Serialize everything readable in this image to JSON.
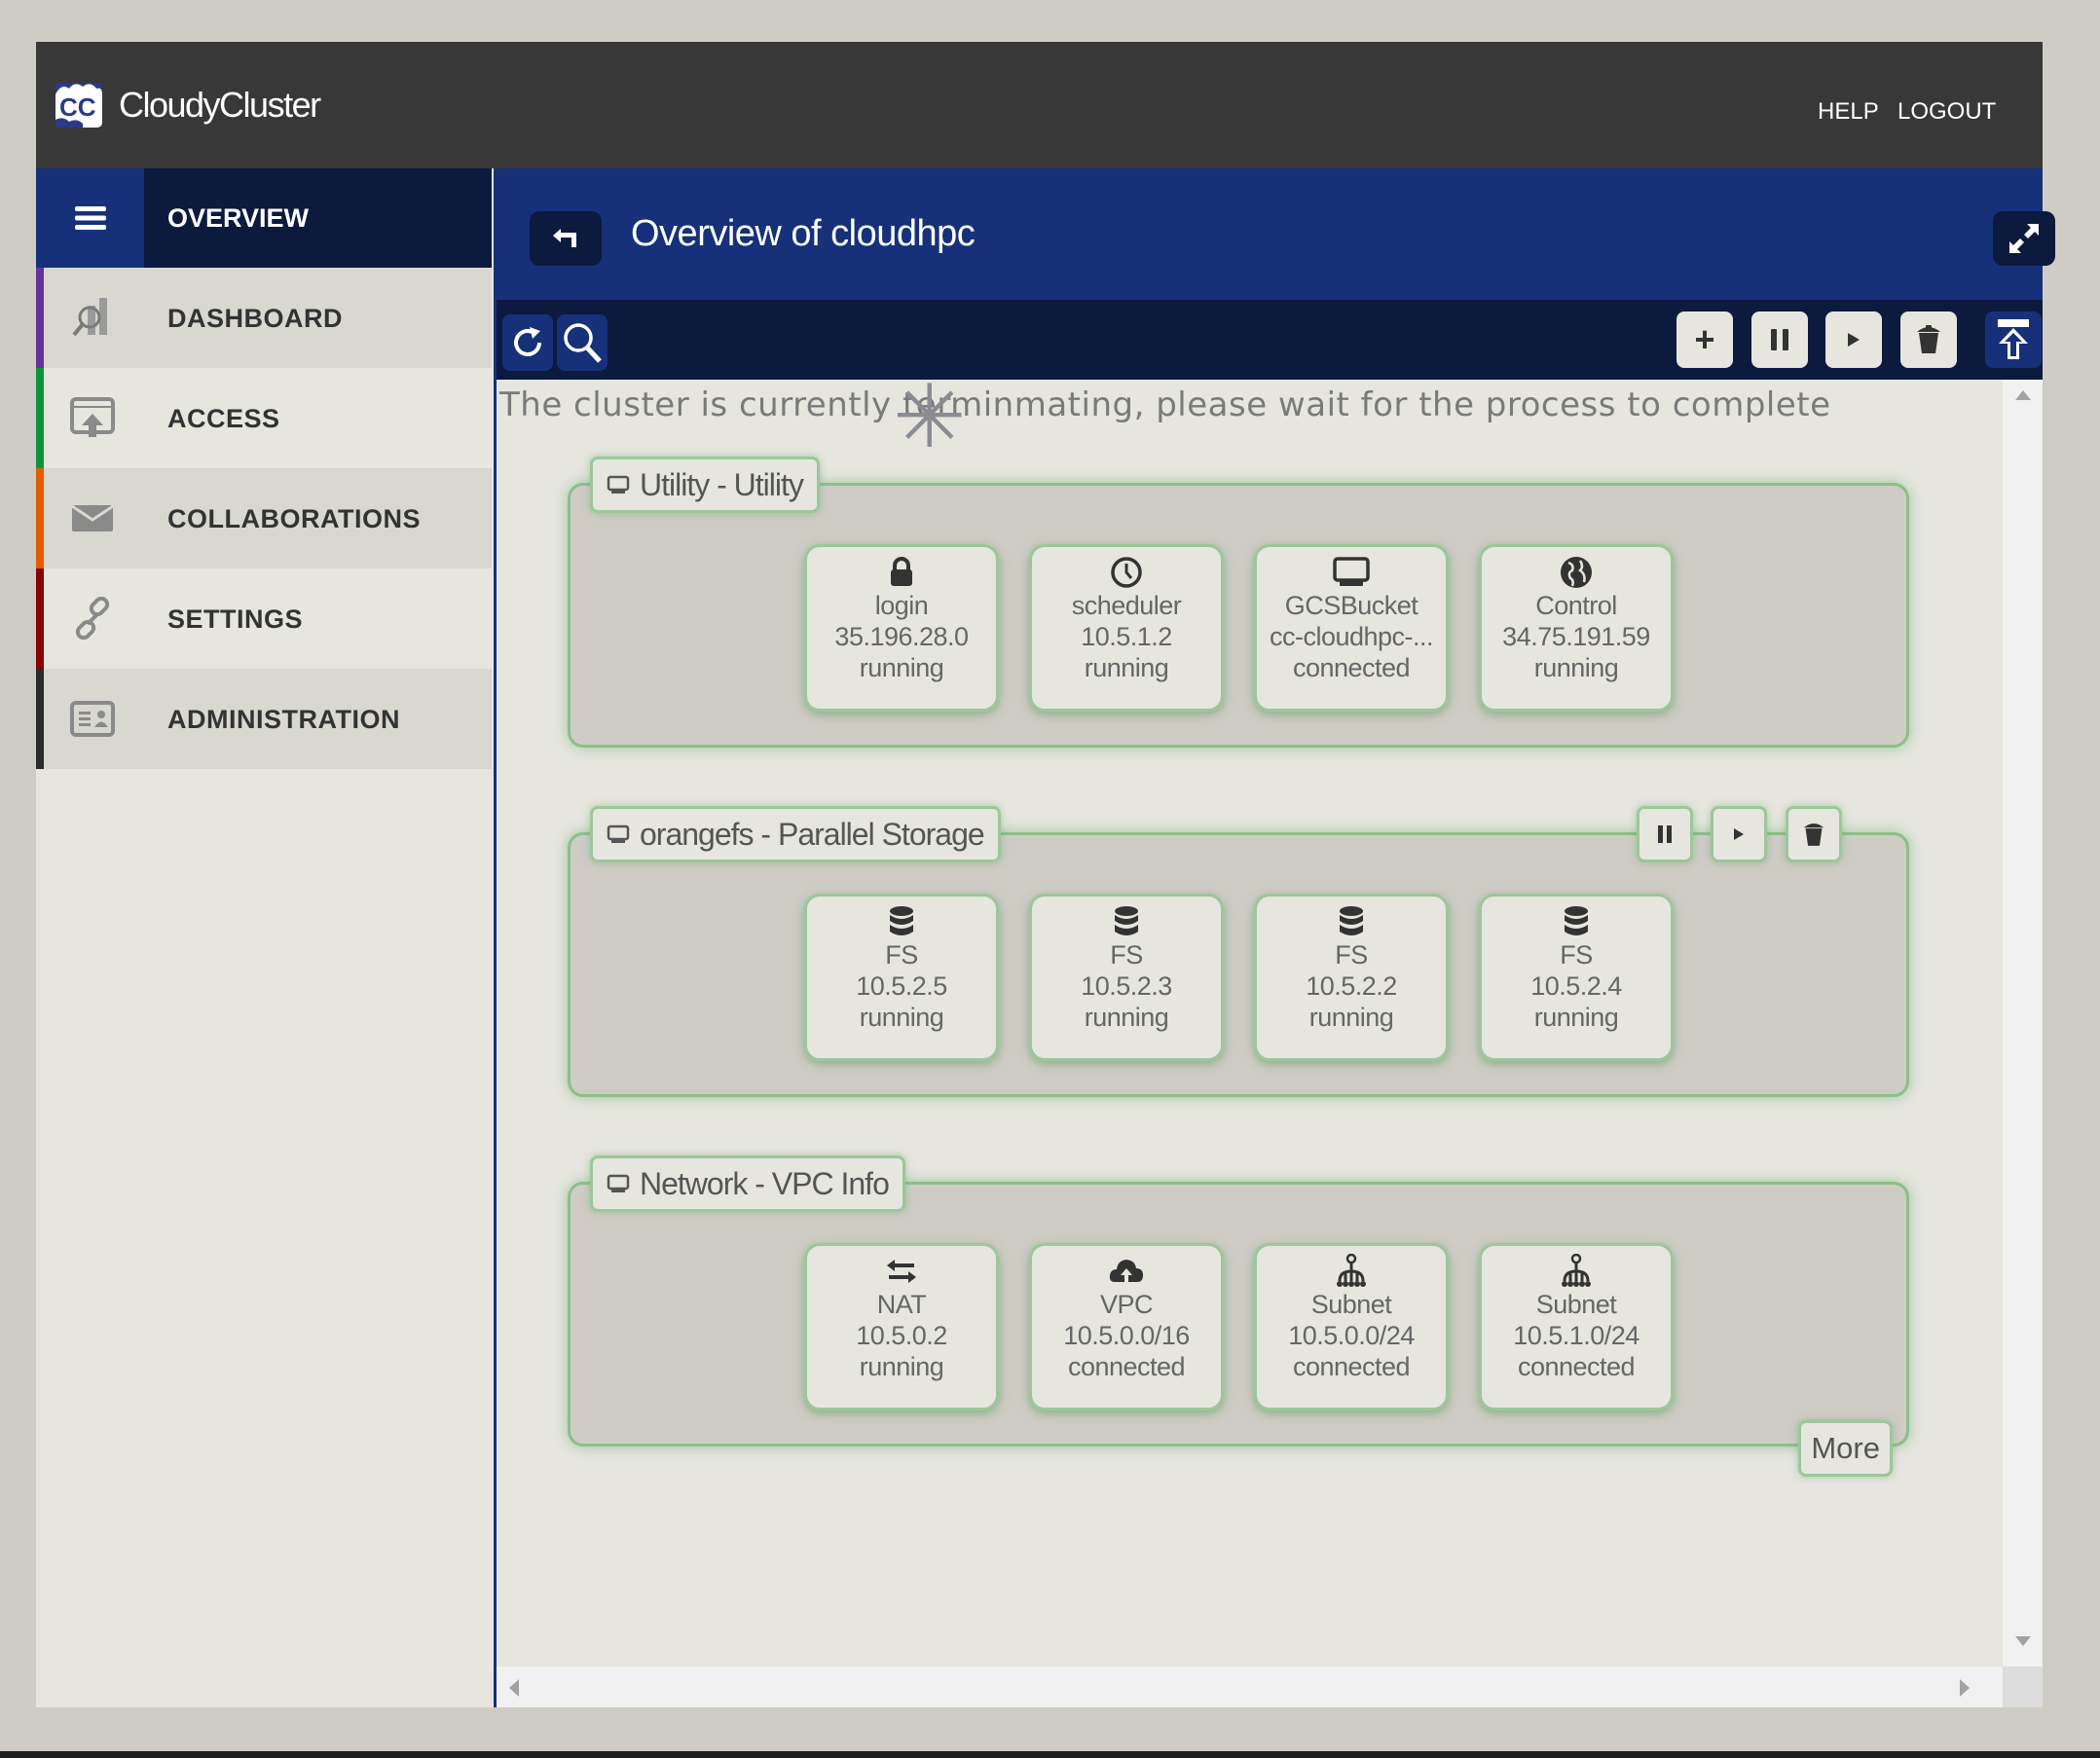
{
  "header": {
    "brand": "CloudyCluster",
    "help": "HELP",
    "logout": "LOGOUT"
  },
  "sidebar": {
    "overview_label": "OVERVIEW",
    "items": [
      {
        "label": "DASHBOARD",
        "icon": "dashboard-icon",
        "color": "#663399"
      },
      {
        "label": "ACCESS",
        "icon": "access-icon",
        "color": "#0a9637"
      },
      {
        "label": "COLLABORATIONS",
        "icon": "envelope-icon",
        "color": "#e35d00"
      },
      {
        "label": "SETTINGS",
        "icon": "link-icon",
        "color": "#8b0000"
      },
      {
        "label": "ADMINISTRATION",
        "icon": "id-card-icon",
        "color": "#2b2b2b"
      }
    ]
  },
  "main": {
    "title": "Overview of cloudhpc",
    "notice": "The cluster is currently terminmating, please wait for the process to complete",
    "toolbar": {
      "add": "+",
      "pause": "pause",
      "play": "play",
      "delete": "delete",
      "upload": "upload"
    },
    "groups": [
      {
        "title": "Utility - Utility",
        "has_actions": false,
        "nodes": [
          {
            "icon": "lock-icon",
            "name": "login",
            "address": "35.196.28.0",
            "status": "running"
          },
          {
            "icon": "clock-icon",
            "name": "scheduler",
            "address": "10.5.1.2",
            "status": "running"
          },
          {
            "icon": "monitor-icon",
            "name": "GCSBucket",
            "address": "cc-cloudhpc-...",
            "status": "connected"
          },
          {
            "icon": "globe-icon",
            "name": "Control",
            "address": "34.75.191.59",
            "status": "running"
          }
        ]
      },
      {
        "title": "orangefs - Parallel Storage",
        "has_actions": true,
        "nodes": [
          {
            "icon": "database-icon",
            "name": "FS",
            "address": "10.5.2.5",
            "status": "running"
          },
          {
            "icon": "database-icon",
            "name": "FS",
            "address": "10.5.2.3",
            "status": "running"
          },
          {
            "icon": "database-icon",
            "name": "FS",
            "address": "10.5.2.2",
            "status": "running"
          },
          {
            "icon": "database-icon",
            "name": "FS",
            "address": "10.5.2.4",
            "status": "running"
          }
        ]
      },
      {
        "title": "Network - VPC Info",
        "has_actions": false,
        "more_label": "More",
        "nodes": [
          {
            "icon": "exchange-icon",
            "name": "NAT",
            "address": "10.5.0.2",
            "status": "running"
          },
          {
            "icon": "cloud-icon",
            "name": "VPC",
            "address": "10.5.0.0/16",
            "status": "connected"
          },
          {
            "icon": "sitemap-icon",
            "name": "Subnet",
            "address": "10.5.0.0/24",
            "status": "connected"
          },
          {
            "icon": "sitemap-icon",
            "name": "Subnet",
            "address": "10.5.1.0/24",
            "status": "connected"
          }
        ]
      }
    ]
  },
  "colors": {
    "header_bg": "#383838",
    "primary_blue": "#16317a",
    "dark_navy": "#0b1a3d",
    "node_border_green": "#8cbf8a",
    "panel_bg": "#e6e6df"
  }
}
